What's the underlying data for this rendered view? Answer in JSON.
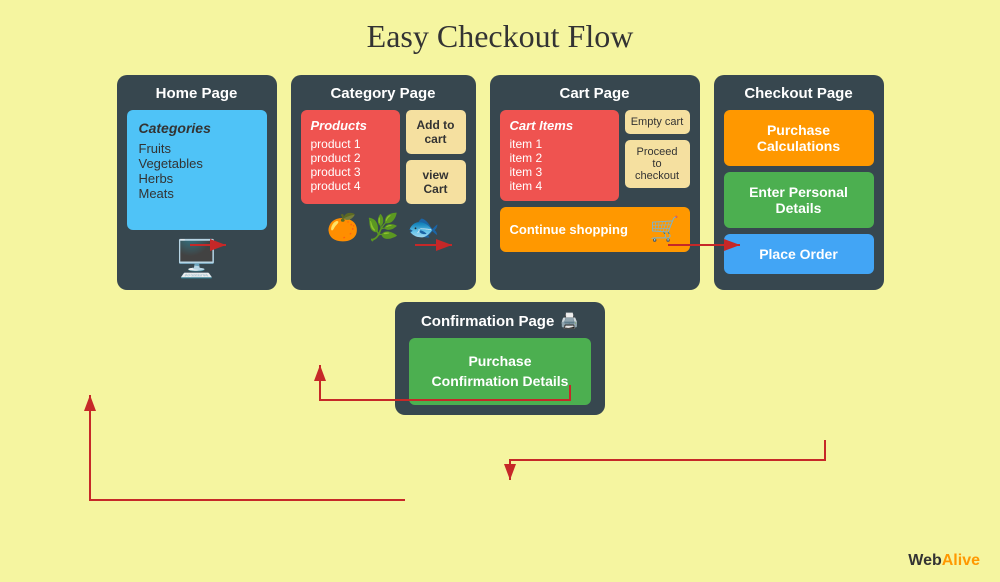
{
  "title": "Easy Checkout Flow",
  "pages": {
    "home": {
      "title": "Home Page",
      "categories_title": "Categories",
      "items": [
        "Fruits",
        "Vegetables",
        "Herbs",
        "Meats"
      ]
    },
    "category": {
      "title": "Category Page",
      "products_title": "Products",
      "products": [
        "product 1",
        "product 2",
        "product 3",
        "product 4"
      ],
      "add_to_cart": "Add to cart",
      "view_cart": "view Cart"
    },
    "cart": {
      "title": "Cart Page",
      "cart_items_title": "Cart Items",
      "items": [
        "item 1",
        "item 2",
        "item 3",
        "item 4"
      ],
      "empty_cart": "Empty cart",
      "proceed_checkout": "Proceed to checkout",
      "continue_shopping": "Continue shopping"
    },
    "checkout": {
      "title": "Checkout Page",
      "purchase_calc": "Purchase Calculations",
      "enter_details": "Enter Personal Details",
      "place_order": "Place Order"
    },
    "confirmation": {
      "title": "Confirmation Page",
      "details": "Purchase Confirmation Details"
    }
  },
  "branding": {
    "web": "Web",
    "alive": "Alive"
  }
}
